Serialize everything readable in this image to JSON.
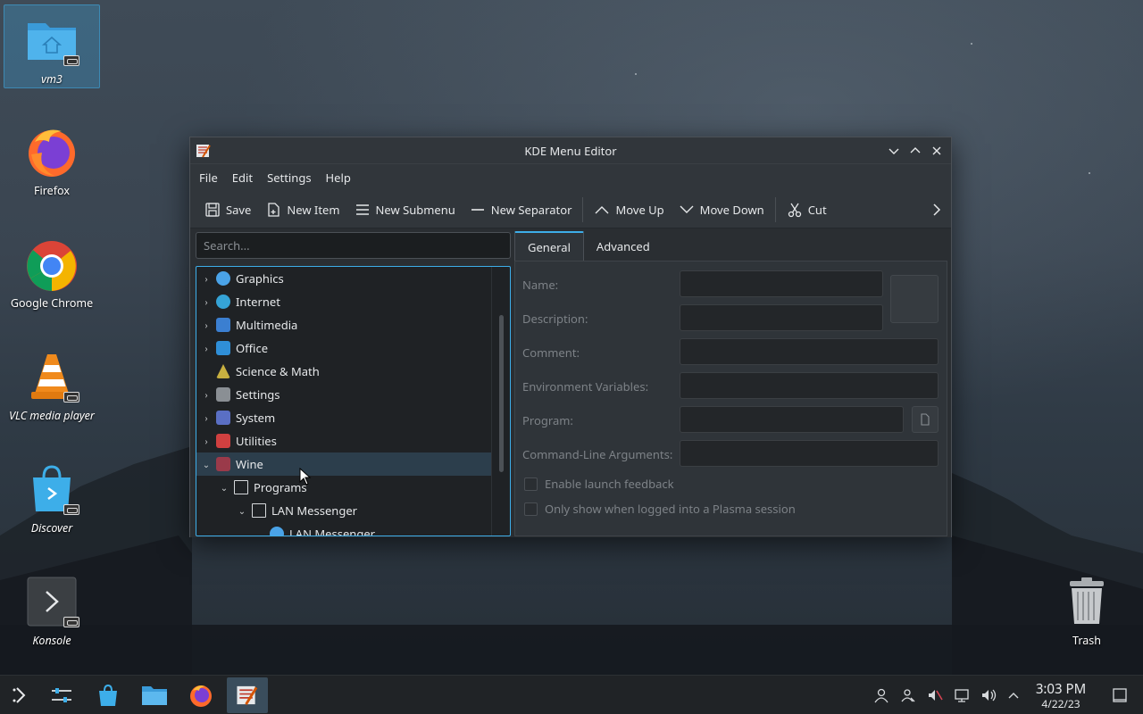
{
  "desktop": {
    "icons": [
      {
        "label": "vm3"
      },
      {
        "label": "Firefox"
      },
      {
        "label": "Google Chrome"
      },
      {
        "label": "VLC media player"
      },
      {
        "label": "Discover"
      },
      {
        "label": "Konsole"
      },
      {
        "label": "Trash"
      }
    ]
  },
  "window": {
    "title": "KDE Menu Editor",
    "menu": [
      "File",
      "Edit",
      "Settings",
      "Help"
    ],
    "toolbar": {
      "save": "Save",
      "new_item": "New Item",
      "new_submenu": "New Submenu",
      "new_separator": "New Separator",
      "move_up": "Move Up",
      "move_down": "Move Down",
      "cut": "Cut"
    },
    "search_placeholder": "Search...",
    "tree": [
      {
        "label": "Graphics",
        "color": "#4aa3e8"
      },
      {
        "label": "Internet",
        "color": "#35a3d6"
      },
      {
        "label": "Multimedia",
        "color": "#3b7fd1"
      },
      {
        "label": "Office",
        "color": "#2f8fd8"
      },
      {
        "label": "Science & Math",
        "color": "#c8b040"
      },
      {
        "label": "Settings",
        "color": "#8a8f94"
      },
      {
        "label": "System",
        "color": "#5a6fc4"
      },
      {
        "label": "Utilities",
        "color": "#d04040"
      },
      {
        "label": "Wine",
        "color": "#9a3a4a"
      },
      {
        "label": "Programs",
        "color": "#d6d9dc"
      },
      {
        "label": "LAN Messenger",
        "color": "#d6d9dc"
      },
      {
        "label": "LAN Messenger",
        "color": "#4aa3e8"
      }
    ],
    "tabs": [
      "General",
      "Advanced"
    ],
    "fields": {
      "name": "Name:",
      "description": "Description:",
      "comment": "Comment:",
      "env": "Environment Variables:",
      "program": "Program:",
      "args": "Command-Line Arguments:"
    },
    "checkboxes": {
      "launch_feedback": "Enable launch feedback",
      "plasma_only": "Only show when logged into a Plasma session"
    }
  },
  "taskbar": {
    "time": "3:03 PM",
    "date": "4/22/23"
  },
  "colors": {
    "accent": "#3daee9",
    "window_bg": "#2a2e32",
    "panel_bg": "#202326"
  }
}
